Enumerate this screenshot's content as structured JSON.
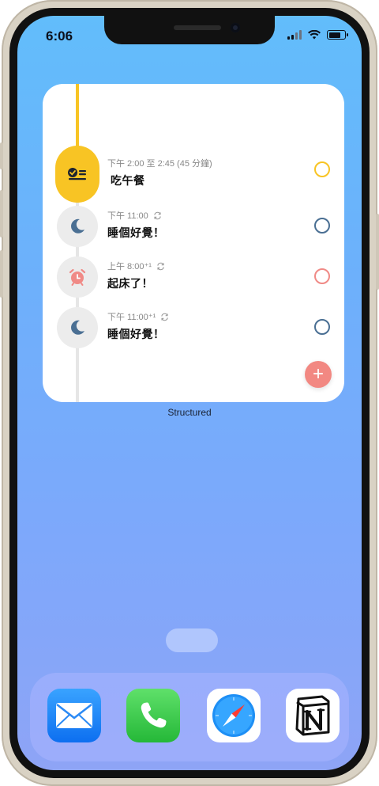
{
  "status_bar": {
    "time": "6:06"
  },
  "widget": {
    "label": "Structured",
    "items": [
      {
        "time": "下午 2:00 至 2:45 (45 分鐘)",
        "title": "吃午餐",
        "icon": "checklist-icon",
        "repeat": false,
        "active": true,
        "check_color": "#f8c424"
      },
      {
        "time": "下午 11:00",
        "title": "睡個好覺！",
        "icon": "moon-icon",
        "repeat": true,
        "active": false,
        "check_color": "#4a6f93"
      },
      {
        "time": "上午 8:00⁺¹",
        "title": "起床了！",
        "icon": "alarm-icon",
        "repeat": true,
        "active": false,
        "check_color": "#f08a86"
      },
      {
        "time": "下午 11:00⁺¹",
        "title": "睡個好覺！",
        "icon": "moon-icon",
        "repeat": true,
        "active": false,
        "check_color": "#4a6f93"
      }
    ],
    "add_button": "+"
  },
  "dock": {
    "apps": [
      "mail-app-icon",
      "phone-app-icon",
      "safari-app-icon",
      "notion-app-icon"
    ]
  },
  "colors": {
    "accent_yellow": "#f8c424",
    "accent_red": "#f28882",
    "moon_blue": "#4a6f93"
  }
}
